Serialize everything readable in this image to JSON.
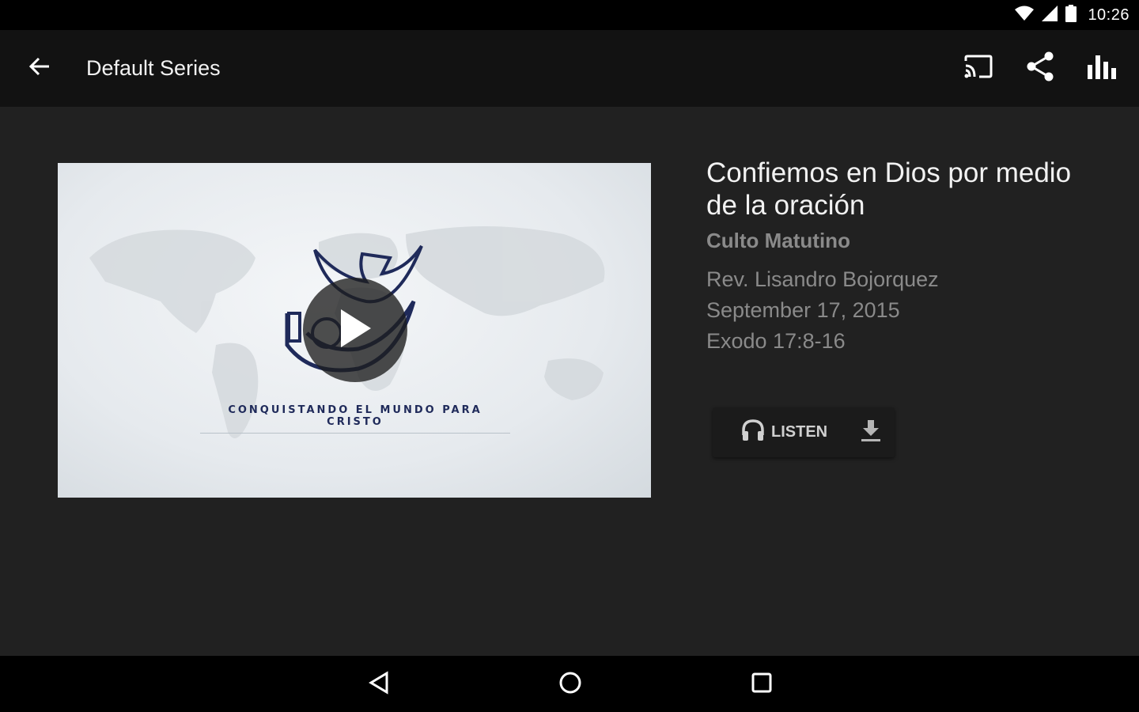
{
  "status_bar": {
    "time": "10:26",
    "icons": [
      "wifi-icon",
      "cell-signal-icon",
      "battery-icon"
    ]
  },
  "toolbar": {
    "title": "Default Series",
    "back_icon": "arrow-back-icon",
    "actions": [
      "cast-icon",
      "share-icon",
      "equalizer-icon"
    ]
  },
  "sermon": {
    "title": "Confiemos en Dios por medio de la oración",
    "series": "Culto Matutino",
    "speaker": "Rev. Lisandro Bojorquez",
    "date": "September 17, 2015",
    "passage": "Exodo 17:8-16"
  },
  "video": {
    "tagline": "CONQUISTANDO EL MUNDO PARA CRISTO",
    "play_icon": "play-icon"
  },
  "audio_actions": {
    "listen_label": "LISTEN",
    "listen_icon": "headphones-icon",
    "download_icon": "download-icon"
  },
  "nav_bar": {
    "buttons": [
      "back-triangle-icon",
      "home-circle-icon",
      "recents-square-icon"
    ]
  },
  "colors": {
    "toolbar_bg": "#121212",
    "content_bg": "#212121",
    "text_primary": "#f2f2f2",
    "text_secondary": "#8a8a8a",
    "logo_navy": "#1f2a5a"
  }
}
